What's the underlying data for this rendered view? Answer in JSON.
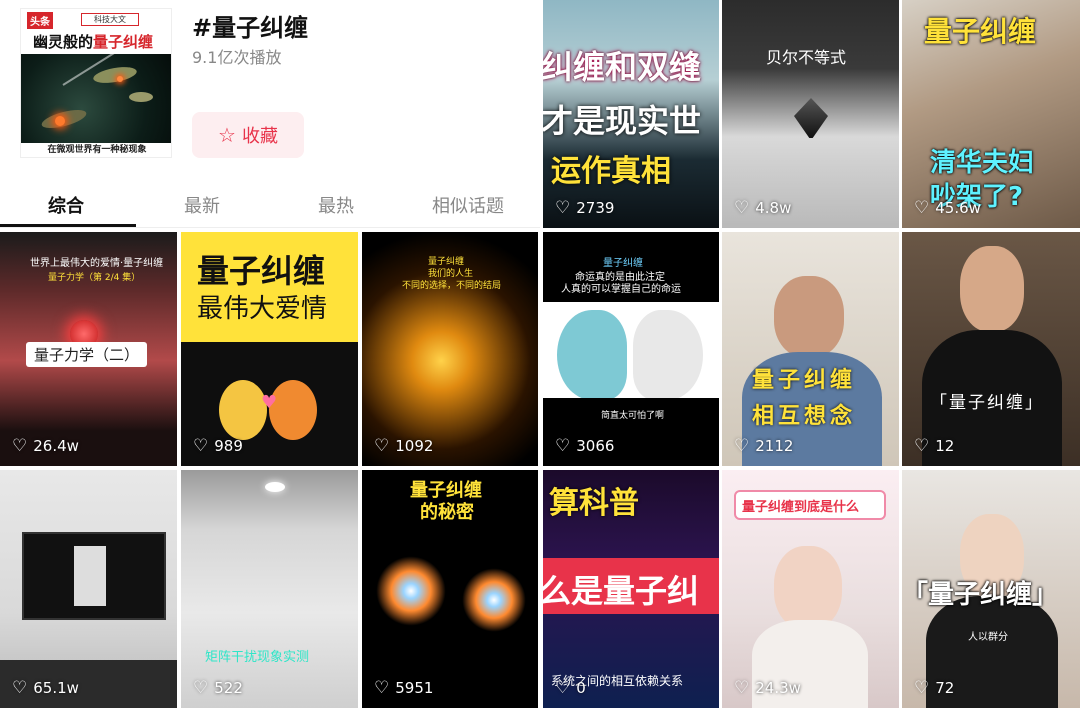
{
  "header": {
    "cover": {
      "brand": "头条",
      "channel": "科技大文",
      "title_prefix": "幽灵般的",
      "title_highlight": "量子纠缠",
      "caption": "在微观世界有一种秘现象"
    },
    "title": "#量子纠缠",
    "plays": "9.1亿次播放",
    "favorite_label": "收藏"
  },
  "tabs": [
    {
      "label": "综合",
      "active": true
    },
    {
      "label": "最新",
      "active": false
    },
    {
      "label": "最热",
      "active": false
    },
    {
      "label": "相似话题",
      "active": false
    }
  ],
  "videos": [
    {
      "texts": [
        "纠缠和双缝",
        "才是现实世",
        "运作真相"
      ],
      "likes": "2739"
    },
    {
      "texts": [
        "贝尔不等式"
      ],
      "likes": "4.8w"
    },
    {
      "texts": [
        "量子纠缠",
        "清华夫妇",
        "吵架了?"
      ],
      "likes": "45.6w"
    },
    {
      "texts": [
        "世界上最伟大的爱情·量子纠缠",
        "量子力学（第 2/4 集）",
        "量子力学（二）"
      ],
      "likes": "26.4w"
    },
    {
      "texts": [
        "量子纠缠",
        "最伟大爱情"
      ],
      "likes": "989"
    },
    {
      "texts": [
        "量子纠缠",
        "我们的人生",
        "不同的选择，不同的结局"
      ],
      "likes": "1092"
    },
    {
      "texts": [
        "量子纠缠",
        "命运真的是由此注定",
        "人真的可以掌握自己的命运",
        "简直太可怕了啊"
      ],
      "likes": "3066"
    },
    {
      "texts": [
        "量子纠缠",
        "相互想念"
      ],
      "likes": "2112"
    },
    {
      "texts": [
        "「量子纠缠」"
      ],
      "likes": "12"
    },
    {
      "texts": [],
      "likes": "65.1w"
    },
    {
      "texts": [
        "矩阵干扰现象实测"
      ],
      "likes": "522"
    },
    {
      "texts": [
        "量子纠缠",
        "的秘密"
      ],
      "likes": "5951"
    },
    {
      "texts": [
        "算科普",
        "么是量子纠",
        "系统之间的相互依赖关系"
      ],
      "likes": "0"
    },
    {
      "texts": [
        "量子纠缠到底是什么"
      ],
      "likes": "24.3w"
    },
    {
      "texts": [
        "「量子纠缠」",
        "人以群分"
      ],
      "likes": "72"
    }
  ],
  "colors": {
    "accent": "#e8334a",
    "accent_bg": "#fdeef0",
    "cover_red": "#d6262c",
    "title_yellow": "#ffe23a"
  }
}
